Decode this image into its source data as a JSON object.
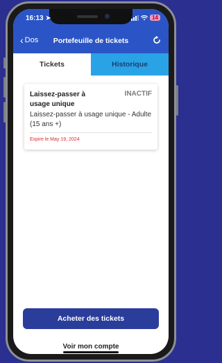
{
  "status_bar": {
    "time": "16:13",
    "battery": "14"
  },
  "nav": {
    "back_label": "Dos",
    "title": "Portefeuille de tickets"
  },
  "tabs": [
    {
      "label": "Tickets",
      "active": true
    },
    {
      "label": "Historique",
      "active": false
    }
  ],
  "ticket": {
    "title": "Laissez-passer à usage unique",
    "status": "INACTIF",
    "description": "Laissez-passer à usage unique - Adulte (15 ans +)",
    "expiry": "Expire le May 19, 2024"
  },
  "actions": {
    "buy_label": "Acheter des tickets",
    "account_label": "Voir mon compte"
  },
  "colors": {
    "header": "#2b55c6",
    "tab_inactive": "#29a3e6",
    "button": "#2b3d9b",
    "expiry": "#e0262b",
    "background": "#2b2f8f"
  },
  "icons": {
    "back": "chevron-left-icon",
    "refresh": "refresh-icon",
    "location": "location-arrow-icon",
    "signal": "signal-bars-icon",
    "wifi": "wifi-icon",
    "battery": "battery-icon"
  }
}
